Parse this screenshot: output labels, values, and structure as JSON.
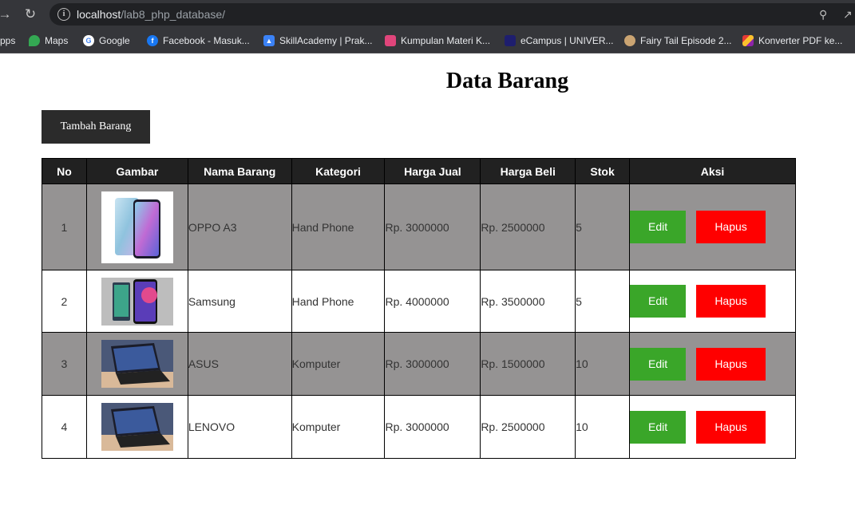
{
  "browser": {
    "url_host": "localhost",
    "url_path": "/lab8_php_database/",
    "bookmarks": [
      {
        "label": "pps",
        "icon": "apps-icon",
        "color": "#35363a"
      },
      {
        "label": "Maps",
        "icon": "maps-icon",
        "color": "#34a853"
      },
      {
        "label": "Google",
        "icon": "google-icon",
        "color": "#ffffff"
      },
      {
        "label": "Facebook - Masuk...",
        "icon": "facebook-icon",
        "color": "#1877f2"
      },
      {
        "label": "SkillAcademy | Prak...",
        "icon": "skillacademy-icon",
        "color": "#3b82f6"
      },
      {
        "label": "Kumpulan Materi K...",
        "icon": "materi-icon",
        "color": "#e0457b"
      },
      {
        "label": "eCampus | UNIVER...",
        "icon": "ecampus-icon",
        "color": "#1e1e6e"
      },
      {
        "label": "Fairy Tail Episode 2...",
        "icon": "fairytail-icon",
        "color": "#caa472"
      },
      {
        "label": "Konverter PDF ke...",
        "icon": "pdf-converter-icon",
        "color": "#e53935"
      }
    ]
  },
  "page": {
    "title": "Data Barang",
    "add_button": "Tambah Barang"
  },
  "table": {
    "headers": [
      "No",
      "Gambar",
      "Nama Barang",
      "Kategori",
      "Harga Jual",
      "Harga Beli",
      "Stok",
      "Aksi"
    ],
    "rows": [
      {
        "no": "1",
        "image": "phone-oppo-image",
        "nama": "OPPO A3",
        "kategori": "Hand Phone",
        "harga_jual": "Rp. 3000000",
        "harga_beli": "Rp. 2500000",
        "stok": "5"
      },
      {
        "no": "2",
        "image": "phone-samsung-image",
        "nama": "Samsung",
        "kategori": "Hand Phone",
        "harga_jual": "Rp. 4000000",
        "harga_beli": "Rp. 3500000",
        "stok": "5"
      },
      {
        "no": "3",
        "image": "laptop-image",
        "nama": "ASUS",
        "kategori": "Komputer",
        "harga_jual": "Rp. 3000000",
        "harga_beli": "Rp. 1500000",
        "stok": "10"
      },
      {
        "no": "4",
        "image": "laptop-image",
        "nama": "LENOVO",
        "kategori": "Komputer",
        "harga_jual": "Rp. 3000000",
        "harga_beli": "Rp. 2500000",
        "stok": "10"
      }
    ],
    "edit_label": "Edit",
    "delete_label": "Hapus"
  },
  "colors": {
    "header_bg": "#212121",
    "row_gray": "#959393",
    "edit_btn": "#3aa629",
    "delete_btn": "#ff0000"
  }
}
